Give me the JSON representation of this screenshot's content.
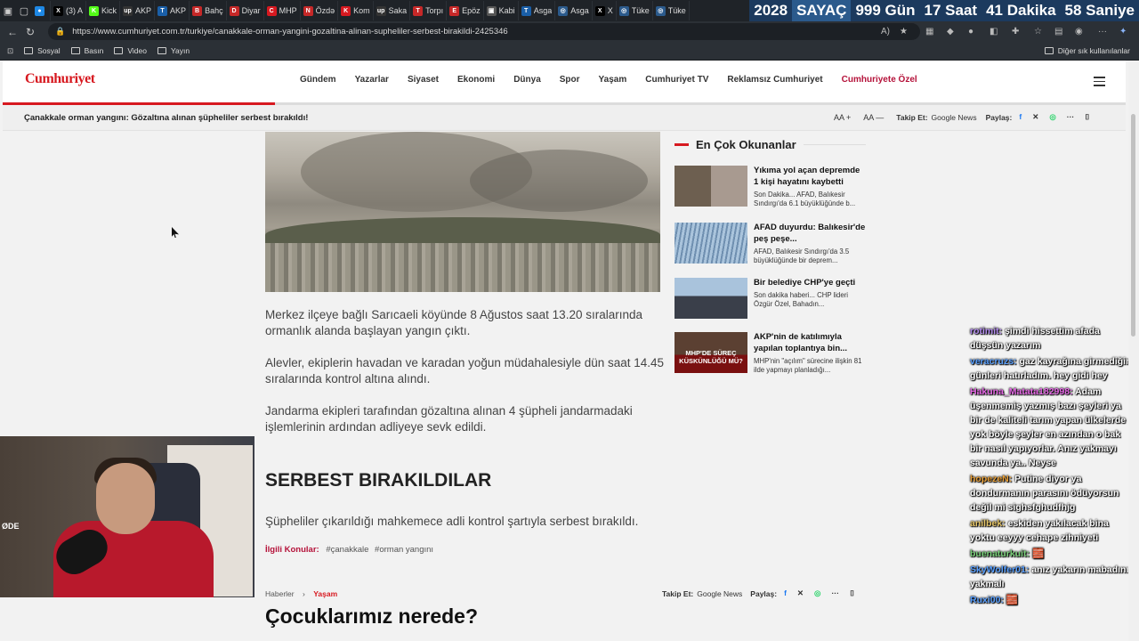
{
  "browser": {
    "tabs": [
      {
        "label": "",
        "color": "#1e88e5",
        "glyph": "●"
      },
      {
        "label": "(3) A",
        "color": "#000000",
        "glyph": "X"
      },
      {
        "label": "Kick",
        "color": "#53fc18",
        "glyph": "K"
      },
      {
        "label": "AKP",
        "color": "#333333",
        "glyph": "up"
      },
      {
        "label": "AKP",
        "color": "#1a5fa8",
        "glyph": "T"
      },
      {
        "label": "Bahç",
        "color": "#c62828",
        "glyph": "B"
      },
      {
        "label": "Diyar",
        "color": "#c62828",
        "glyph": "D"
      },
      {
        "label": "MHP",
        "color": "#d71920",
        "glyph": "C"
      },
      {
        "label": "Özdə",
        "color": "#c62828",
        "glyph": "N"
      },
      {
        "label": "Kom",
        "color": "#d71920",
        "glyph": "K"
      },
      {
        "label": "Saka",
        "color": "#333333",
        "glyph": "up"
      },
      {
        "label": "Torpı",
        "color": "#c62828",
        "glyph": "T"
      },
      {
        "label": "Epöz",
        "color": "#c62828",
        "glyph": "E"
      },
      {
        "label": "Kabi",
        "color": "#555555",
        "glyph": "▣"
      },
      {
        "label": "Asga",
        "color": "#1a5fa8",
        "glyph": "T"
      },
      {
        "label": "Asga",
        "color": "#2b5a8c",
        "glyph": "◎"
      },
      {
        "label": "X",
        "color": "#000000",
        "glyph": "X"
      },
      {
        "label": "Tüke",
        "color": "#2b5a8c",
        "glyph": "◎"
      },
      {
        "label": "Tüke",
        "color": "#2b5a8c",
        "glyph": "◎"
      }
    ],
    "url": "https://www.cumhuriyet.com.tr/turkiye/canakkale-orman-yangini-gozaltina-alinan-supheliler-serbest-birakildi-2425346",
    "bookmarks": [
      "Sosyal",
      "Basın",
      "Video",
      "Yayın"
    ],
    "other_bookmarks": "Diğer sık kullanılanlar"
  },
  "counter": {
    "year": "2028",
    "label": "SAYAÇ",
    "days": "999 Gün",
    "hours": "17 Saat",
    "minutes": "41 Dakika",
    "seconds": "58 Saniye"
  },
  "site": {
    "logo": "Cumhuriyet",
    "menu": [
      "Gündem",
      "Yazarlar",
      "Siyaset",
      "Ekonomi",
      "Dünya",
      "Spor",
      "Yaşam",
      "Cumhuriyet TV",
      "Reklamsız Cumhuriyet"
    ],
    "menu_special": "Cumhuriyete Özel",
    "sticky_title": "Çanakkale orman yangını: Gözaltına alınan şüpheliler serbest bırakıldı!",
    "follow_label": "Takip Et:",
    "share_label": "Paylaş:",
    "google_news": "Google News"
  },
  "article": {
    "paragraphs": [
      "Merkez ilçeye bağlı Sarıcaeli köyünde 8 Ağustos saat 13.20 sıralarında ormanlık alanda başlayan yangın çıktı.",
      "Alevler, ekiplerin havadan ve karadan yoğun müdahalesiyle dün saat 14.45 sıralarında kontrol altına alındı.",
      "Jandarma ekipleri tarafından gözaltına alınan 4 şüpheli jandarmadaki işlemlerinin ardından adliyeye sevk edildi."
    ],
    "subheading": "SERBEST BIRAKILDILAR",
    "paragraph4": "Şüpheliler çıkarıldığı mahkemece adli kontrol şartıyla serbest bırakıldı.",
    "tags_label": "İlgili Konular:",
    "tags": [
      "#çanakkale",
      "#orman yangını"
    ],
    "breadcrumb_home": "Haberler",
    "breadcrumb_current": "Yaşam",
    "next_title": "Çocuklarımız nerede?"
  },
  "sidebar": {
    "title": "En Çok Okunanlar",
    "items": [
      {
        "title": "Yıkıma yol açan depremde 1 kişi hayatını kaybetti",
        "desc": "Son Dakika... AFAD, Balıkesir Sındırgı'da 6.1 büyüklüğünde b..."
      },
      {
        "title": "AFAD duyurdu: Balıkesir'de peş peşe...",
        "desc": "AFAD, Balıkesir Sındırgı'da 3.5 büyüklüğünde bir deprem..."
      },
      {
        "title": "Bir belediye CHP'ye geçti",
        "desc": "Son dakika haberi... CHP lideri Özgür Özel, Bahadın..."
      },
      {
        "title": "AKP'nin de katılımıyla yapılan toplantıya bin...",
        "desc": "MHP'nin \"açılım\" sürecine ilişkin 81 ilde yapmayı planladığı...",
        "thumb_text": "MHP'DE SÜREÇ KÜSKÜNLÜĞÜ MÜ?"
      }
    ]
  },
  "webcam_text": "ØDE",
  "chat": [
    {
      "user": "rotimit:",
      "color": "#b48cf0",
      "msg": "şimdi hissettim afada düşsün yazarım"
    },
    {
      "user": "veracruzs:",
      "color": "#5aa0ff",
      "msg": "gaz kayrağına girmediğim günleri hatırladım. hey gidi hey"
    },
    {
      "user": "Hakuna_Matata182998:",
      "color": "#e86ae8",
      "msg": "Adam üşenmemiş yazmış bazı şeyleri ya bir de kaliteli tarım yapan ülkelerde yok böyle şeyler en azından o bak bir nasıl yapıyorlar. Anız yakmayı savunda ya.. Neyse"
    },
    {
      "user": "hopezeN:",
      "color": "#e8a03a",
      "msg": "Putine diyor ya dondurmanın parasını ödüyorsun değil mi sighsfghudfhjg"
    },
    {
      "user": "anilbek:",
      "color": "#e8c86a",
      "msg": "eskiden yakılacak bina yoktu eeyyy cehape zihniyeti"
    },
    {
      "user": "buenaturkuit:",
      "color": "#7ad07a",
      "msg": "🧱"
    },
    {
      "user": "SkyWolfer01:",
      "color": "#5aa0ff",
      "msg": "anız yakarın mabadını yakmalı"
    },
    {
      "user": "Ruxi00:",
      "color": "#5aa0ff",
      "msg": "🧱"
    }
  ]
}
